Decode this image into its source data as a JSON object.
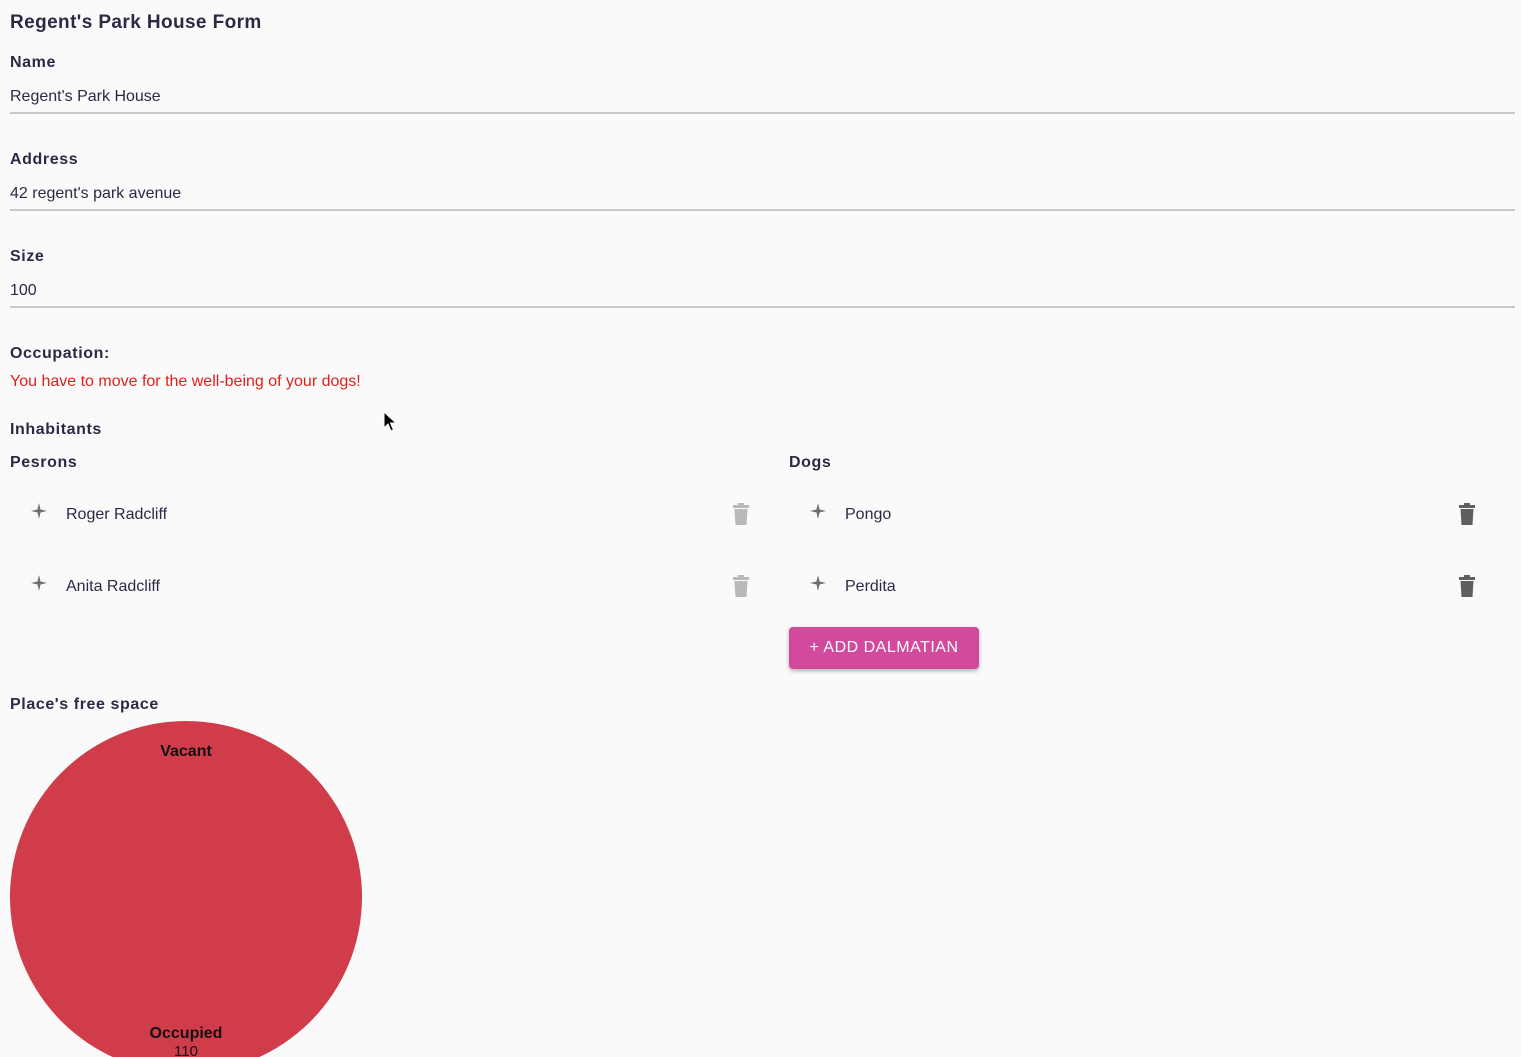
{
  "form": {
    "title": "Regent's Park House Form"
  },
  "fields": {
    "name": {
      "label": "Name",
      "value": "Regent's Park House"
    },
    "address": {
      "label": "Address",
      "value": "42 regent's park avenue"
    },
    "size": {
      "label": "Size",
      "value": "100"
    }
  },
  "occupation": {
    "label": "Occupation:",
    "warning": "You have to move for the well-being of your dogs!",
    "warning_color": "#e0201d"
  },
  "inhabitants": {
    "label": "Inhabitants",
    "persons": {
      "label": "Pesrons",
      "items": [
        "Roger Radcliff",
        "Anita Radcliff"
      ]
    },
    "dogs": {
      "label": "Dogs",
      "items": [
        "Pongo",
        "Perdita"
      ]
    },
    "add_button_label": "+ ADD DALMATIAN",
    "add_button_color": "#d14a9e"
  },
  "icons": {
    "drag": "drag-handle-icon",
    "delete": "trash-icon"
  },
  "free_space": {
    "label": "Place's free space"
  },
  "chart_data": {
    "type": "pie",
    "categories": [
      "Vacant",
      "Occupied"
    ],
    "values": [
      0,
      110
    ],
    "value_labels": [
      "",
      "110"
    ],
    "colors": [
      "#d13c4b",
      "#d13c4b"
    ]
  }
}
